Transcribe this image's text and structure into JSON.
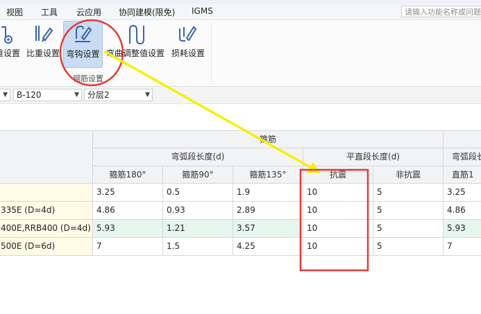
{
  "menubar": {
    "items": [
      "视图",
      "工具",
      "云应用",
      "协同建模(限免)",
      "IGMS"
    ],
    "search_placeholder": "请输入功能名称或问题"
  },
  "ribbon": {
    "buttons": [
      {
        "label": "重设置",
        "icon": "gear-icon"
      },
      {
        "label": "比重设置",
        "icon": "pencil-ruler-icon"
      },
      {
        "label": "弯钩设置",
        "icon": "hook-pencil-icon"
      },
      {
        "label": "弯曲调整值设置",
        "icon": "bend-icon"
      },
      {
        "label": "损耗设置",
        "icon": "loss-pencil-icon"
      }
    ],
    "group_label": "钢筋设置"
  },
  "filterbar": {
    "dropdown1": "",
    "dropdown2": "B-120",
    "dropdown3": "分层2"
  },
  "table": {
    "group_header": "箍筋",
    "sub_headers": [
      "弯弧段长度(d)",
      "平直段长度(d)",
      "弯弧段长"
    ],
    "col_headers": [
      "箍筋180°",
      "箍筋90°",
      "箍筋135°",
      "抗震",
      "非抗震",
      "直筋1"
    ],
    "rows": [
      {
        "label": "",
        "values": [
          "3.25",
          "0.5",
          "1.9",
          "10",
          "5",
          "3.25"
        ],
        "highlight": false
      },
      {
        "label": "335E (D=4d)",
        "values": [
          "4.86",
          "0.93",
          "2.89",
          "10",
          "5",
          "4.86"
        ],
        "highlight": false
      },
      {
        "label": "400E,RRB400 (D=4d)",
        "values": [
          "5.93",
          "1.21",
          "3.57",
          "10",
          "5",
          "5.93"
        ],
        "highlight": true
      },
      {
        "label": "500E (D=6d)",
        "values": [
          "7",
          "1.5",
          "4.25",
          "10",
          "5",
          "7"
        ],
        "highlight": false
      }
    ]
  },
  "annotations": {
    "circle_color": "#e53935",
    "box_color": "#e53935",
    "arrow_color": "#f5f000"
  }
}
